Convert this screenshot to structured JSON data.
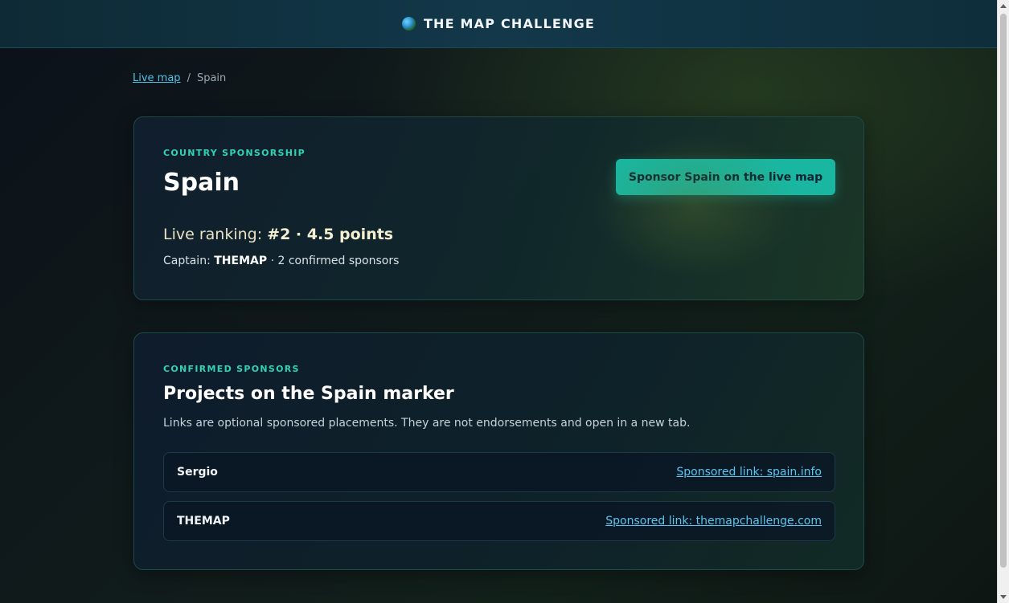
{
  "header": {
    "title": "THE MAP CHALLENGE",
    "icon": "globe-icon"
  },
  "breadcrumb": {
    "home_label": "Live map",
    "separator": "/",
    "current": "Spain"
  },
  "country_card": {
    "eyebrow": "COUNTRY SPONSORSHIP",
    "title": "Spain",
    "ranking_label": "Live ranking:",
    "ranking_value": "#2 · 4.5 points",
    "captain_label": "Captain:",
    "captain_name": "THEMAP",
    "sponsor_count": "· 2 confirmed sponsors",
    "sponsor_button": "Sponsor Spain on the live map"
  },
  "sponsors_card": {
    "eyebrow": "CONFIRMED SPONSORS",
    "title": "Projects on the Spain marker",
    "description": "Links are optional sponsored placements. They are not endorsements and open in a new tab.",
    "rows": [
      {
        "name": "Sergio",
        "link": "Sponsored link: spain.info"
      },
      {
        "name": "THEMAP",
        "link": "Sponsored link: themapchallenge.com"
      }
    ]
  },
  "colors": {
    "accent": "#19b7a2",
    "eyebrow": "#2fd3b5",
    "link": "#5cc4ef"
  }
}
